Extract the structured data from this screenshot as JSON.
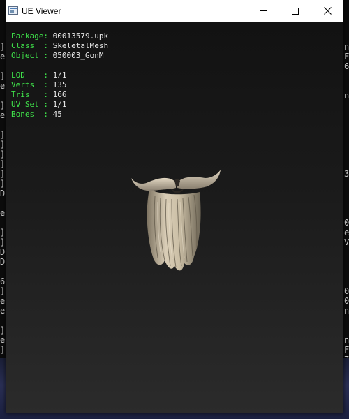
{
  "background_console": {
    "left_chars": [
      "]",
      "e",
      "",
      "]",
      "e",
      "",
      "]",
      "e",
      "",
      "]",
      "]",
      "]",
      "]",
      "]",
      "]",
      "D",
      "",
      "e",
      "",
      "]",
      "]",
      "D",
      "D",
      "",
      "6",
      "]",
      "e",
      "e",
      "",
      "]",
      "e",
      "]"
    ],
    "right_chars": [
      "n",
      "F",
      "6",
      "",
      "",
      "n",
      "",
      "",
      "",
      "",
      "",
      "",
      "",
      "3",
      "",
      "",
      "",
      "",
      "0",
      "e",
      "V",
      "",
      "",
      "",
      "",
      "0",
      "0",
      "n",
      "",
      "",
      "n",
      "F",
      "7"
    ]
  },
  "window": {
    "title": "UE Viewer",
    "controls": {
      "minimize": "minimize",
      "maximize": "maximize",
      "close": "close"
    }
  },
  "mesh_info": {
    "package": {
      "label": "Package: ",
      "value": "00013579.upk"
    },
    "class": {
      "label": "Class  : ",
      "value": "SkeletalMesh"
    },
    "object": {
      "label": "Object : ",
      "value": "050003_GonM"
    },
    "lod": {
      "label": "LOD    : ",
      "value": "1/1"
    },
    "verts": {
      "label": "Verts  : ",
      "value": "135"
    },
    "tris": {
      "label": "Tris   : ",
      "value": "166"
    },
    "uv_set": {
      "label": "UV Set : ",
      "value": "1/1"
    },
    "bones": {
      "label": "Bones  : ",
      "value": "45"
    }
  },
  "colors": {
    "label_green": "#3fe04a",
    "value_white": "#e6e6e6",
    "beard_light": "#d8ccb4",
    "beard_dark": "#5c5446"
  }
}
